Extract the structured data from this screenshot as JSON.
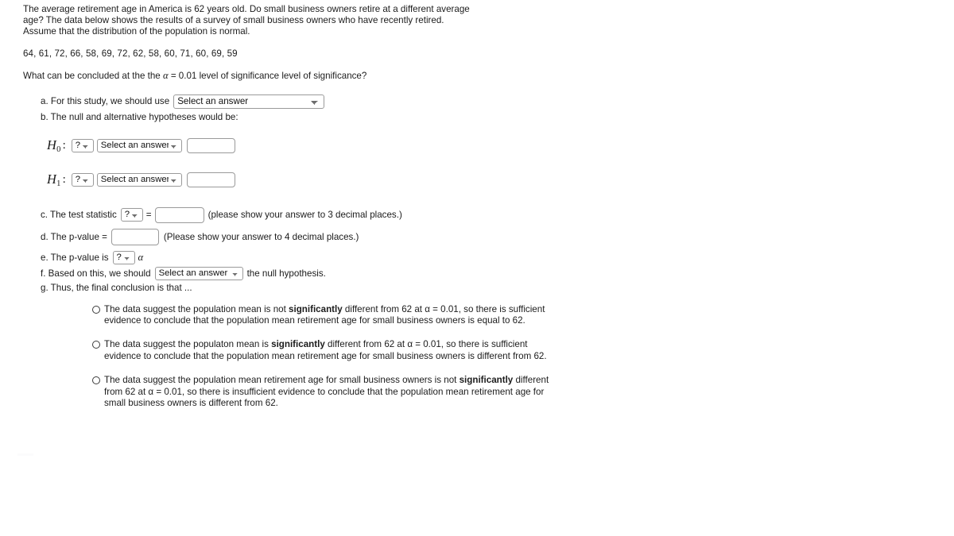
{
  "problem": {
    "intro_lines": [
      "The average retirement age in America is 62 years old. Do small business owners retire at a different average",
      "age? The data below shows the results of a survey of small business owners who have recently retired.",
      "Assume that the distribution of the population is normal."
    ],
    "data_values": "64, 61, 72, 66, 58, 69, 72, 62, 58, 60, 71, 60, 69, 59",
    "question_prefix": "What can be concluded at the the ",
    "question_alpha": "α",
    "question_suffix": " = 0.01 level of significance level of significance?"
  },
  "items": {
    "a": {
      "label": "a. For this study, we should use",
      "select_value": "Select an answer"
    },
    "b": {
      "label": "b. The null and alternative hypotheses would be:",
      "null_hypothesis": {
        "symbol": "H",
        "subscript": "0",
        "colon": ":",
        "operand_select": "?",
        "answer_select": "Select an answer",
        "value_input": ""
      },
      "alt_hypothesis": {
        "symbol": "H",
        "subscript": "1",
        "colon": ":",
        "operand_select": "?",
        "answer_select": "Select an answer",
        "value_input": ""
      }
    },
    "c": {
      "label": "c. The test statistic",
      "stat_select": "?",
      "equals": "=",
      "value_input": "",
      "hint": "(please show your answer to 3 decimal places.)"
    },
    "d": {
      "label": "d. The p-value =",
      "value_input": "",
      "hint": "(Please show your answer to 4 decimal places.)"
    },
    "e": {
      "label": "e. The p-value is",
      "compare_select": "?",
      "alpha": "α"
    },
    "f": {
      "label_before": "f. Based on this, we should",
      "decision_select": "Select an answer",
      "label_after": "the null hypothesis."
    },
    "g": {
      "label": "g. Thus, the final conclusion is that ..."
    }
  },
  "conclusion_options": [
    {
      "pre": "The data suggest the population mean is not ",
      "bold": "significantly",
      "post": " different from 62 at α = 0.01, so there is sufficient evidence to conclude that the population mean retirement age for small business owners is equal to 62.",
      "selected": false
    },
    {
      "pre": "The data suggest the populaton mean is ",
      "bold": "significantly",
      "post": " different from 62 at α = 0.01, so there is sufficient evidence to conclude that the population mean retirement age for small business owners is different from 62.",
      "selected": false
    },
    {
      "pre": "The data suggest the population mean retirement age for small business owners is not ",
      "bold": "significantly",
      "post": " different from 62 at α = 0.01, so there is insufficient evidence to conclude that the population mean retirement age for small business owners is different from 62.",
      "selected": false
    }
  ],
  "colors": {
    "text": "#1c1c1c",
    "field_border": "#9a9a9a",
    "background": "#ffffff"
  }
}
